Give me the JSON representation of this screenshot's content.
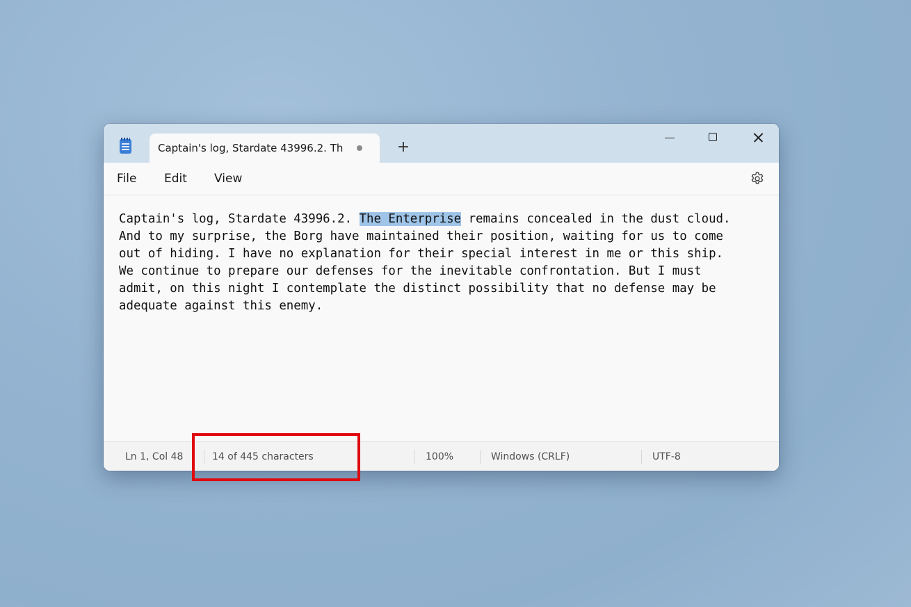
{
  "window": {
    "tab_title": "Captain's log, Stardate 43996.2. Th",
    "new_tab_symbol": "+",
    "minimize_label": "",
    "maximize_label": "",
    "close_label": ""
  },
  "menu": {
    "file": "File",
    "edit": "Edit",
    "view": "View"
  },
  "editor": {
    "lines": [
      {
        "before": "Captain's log, Stardate 43996.2. ",
        "selected": "The Enterprise",
        "after": " remains concealed in the dust cloud."
      },
      {
        "text": "And to my surprise, the Borg have maintained their position, waiting for us to come"
      },
      {
        "text": "out of hiding. I have no explanation for their special interest in me or this ship."
      },
      {
        "text": "We continue to prepare our defenses for the inevitable confrontation. But I must"
      },
      {
        "text": "admit, on this night I contemplate the distinct possibility that no defense may be"
      },
      {
        "text": "adequate against this enemy."
      }
    ],
    "selection_color": "#9fc4e8"
  },
  "status": {
    "position": "Ln 1, Col 48",
    "characters": "14 of 445 characters",
    "zoom": "100%",
    "line_endings": "Windows (CRLF)",
    "encoding": "UTF-8"
  },
  "annotation": {
    "color": "#e0080f"
  },
  "icons": {
    "app": "notepad-icon",
    "unsaved": "unsaved-dot-icon",
    "settings": "gear-icon"
  }
}
